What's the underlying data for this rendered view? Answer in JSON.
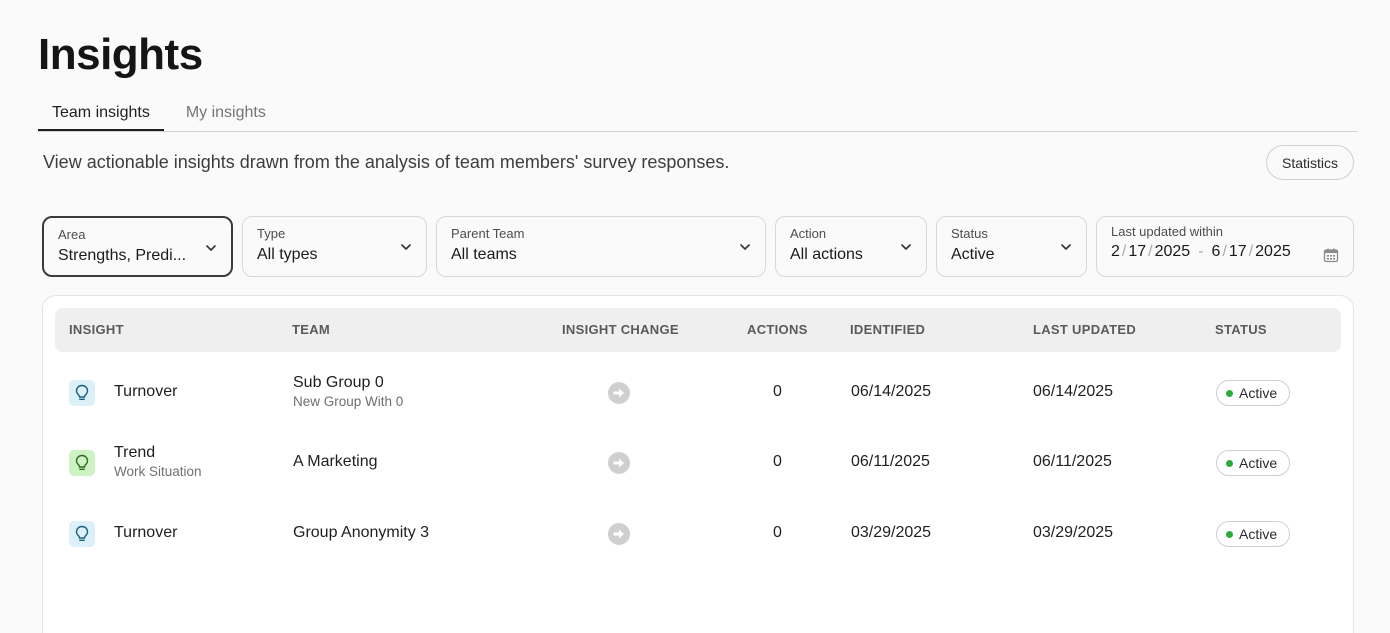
{
  "page": {
    "title": "Insights",
    "description": "View actionable insights drawn from the analysis of team members' survey responses."
  },
  "tabs": [
    {
      "label": "Team insights",
      "active": true
    },
    {
      "label": "My insights",
      "active": false
    }
  ],
  "statistics_button": "Statistics",
  "filters": {
    "area": {
      "label": "Area",
      "value": "Strengths, Predi..."
    },
    "type": {
      "label": "Type",
      "value": "All types"
    },
    "parent_team": {
      "label": "Parent Team",
      "value": "All teams"
    },
    "action": {
      "label": "Action",
      "value": "All actions"
    },
    "status": {
      "label": "Status",
      "value": "Active"
    },
    "last_updated": {
      "label": "Last updated within",
      "from": {
        "m": "2",
        "d": "17",
        "y": "2025"
      },
      "to": {
        "m": "6",
        "d": "17",
        "y": "2025"
      },
      "separator": "/",
      "range_separator": "-"
    }
  },
  "table": {
    "headers": {
      "insight": "INSIGHT",
      "team": "TEAM",
      "insight_change": "INSIGHT CHANGE",
      "actions": "ACTIONS",
      "identified": "IDENTIFIED",
      "last_updated": "LAST UPDATED",
      "status": "STATUS"
    },
    "rows": [
      {
        "insight": "Turnover",
        "insight_sub": "",
        "team": "Sub Group 0",
        "team_sub": "New Group With 0",
        "actions": "0",
        "identified": "06/14/2025",
        "last_updated": "06/14/2025",
        "status": "Active"
      },
      {
        "insight": "Trend",
        "insight_sub": "Work Situation",
        "team": "A Marketing",
        "team_sub": "",
        "actions": "0",
        "identified": "06/11/2025",
        "last_updated": "06/11/2025",
        "status": "Active"
      },
      {
        "insight": "Turnover",
        "insight_sub": "",
        "team": "Group Anonymity 3",
        "team_sub": "",
        "actions": "0",
        "identified": "03/29/2025",
        "last_updated": "03/29/2025",
        "status": "Active"
      }
    ]
  },
  "colors": {
    "status_active": "#2eaa3c",
    "bulb_turnover_bg": "#dcf0fa",
    "bulb_trend_bg": "#cdf3c4"
  },
  "icons": {
    "insight": "lightbulb-icon",
    "change": "arrow-right-circle-icon",
    "dropdown": "chevron-down-icon",
    "date": "calendar-icon"
  }
}
